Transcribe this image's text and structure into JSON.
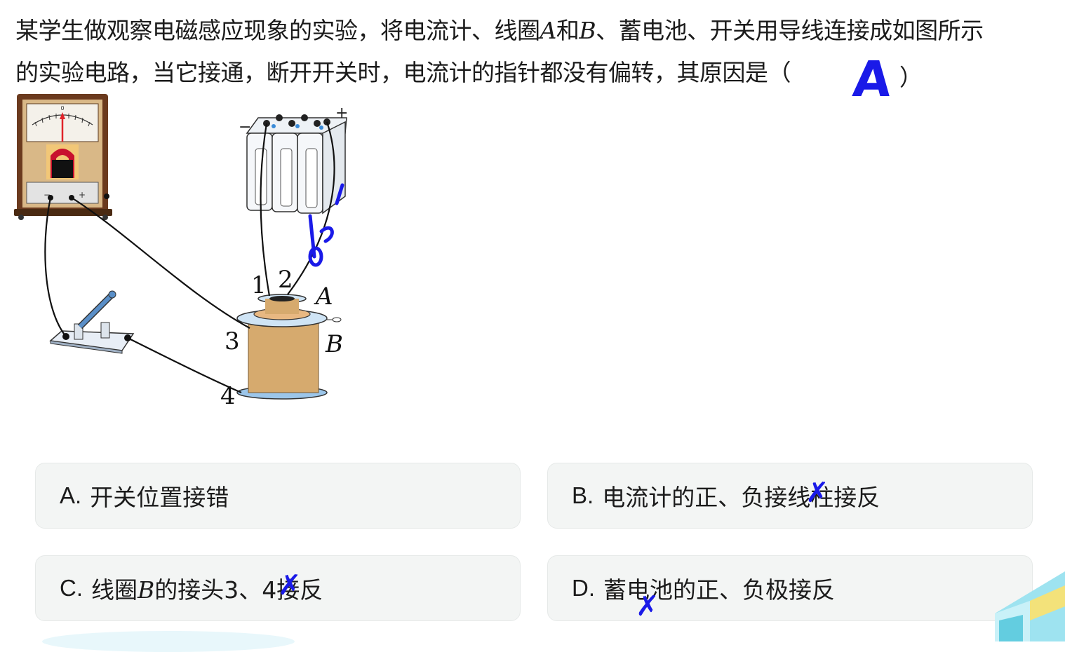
{
  "question": {
    "line1_before_a": "某学生做观察电磁感应现象的实验，将电流计、线圈",
    "var_a": "A",
    "and_text": "和",
    "var_b": "B",
    "line1_after_b": "、蓄电池、开关用导线连接成如图所示",
    "line2": "的实验电路，当它接通，断开开关时，电流计的指针都没有偏转，其原因是（",
    "close_paren": "）",
    "handwritten_answer": "A"
  },
  "figure": {
    "label_minus": "−",
    "label_plus": "+",
    "label_1": "1",
    "label_2": "2",
    "label_3": "3",
    "label_4": "4",
    "label_coil_a": "A",
    "label_coil_b": "B",
    "meter_minus": "−",
    "meter_plus": "+",
    "meter_zero": "0"
  },
  "options": [
    {
      "letter": "A.",
      "text": "开关位置接错"
    },
    {
      "letter": "B.",
      "text": "电流计的正、负接线柱接反"
    },
    {
      "letter": "C.",
      "text_before": "线圈",
      "var": "B",
      "text_after": "的接头3、4接反"
    },
    {
      "letter": "D.",
      "text": "蓄电池的正、负极接反"
    }
  ],
  "marks": {
    "x_symbol": "✗",
    "ink_color": "#1a1ae8"
  }
}
